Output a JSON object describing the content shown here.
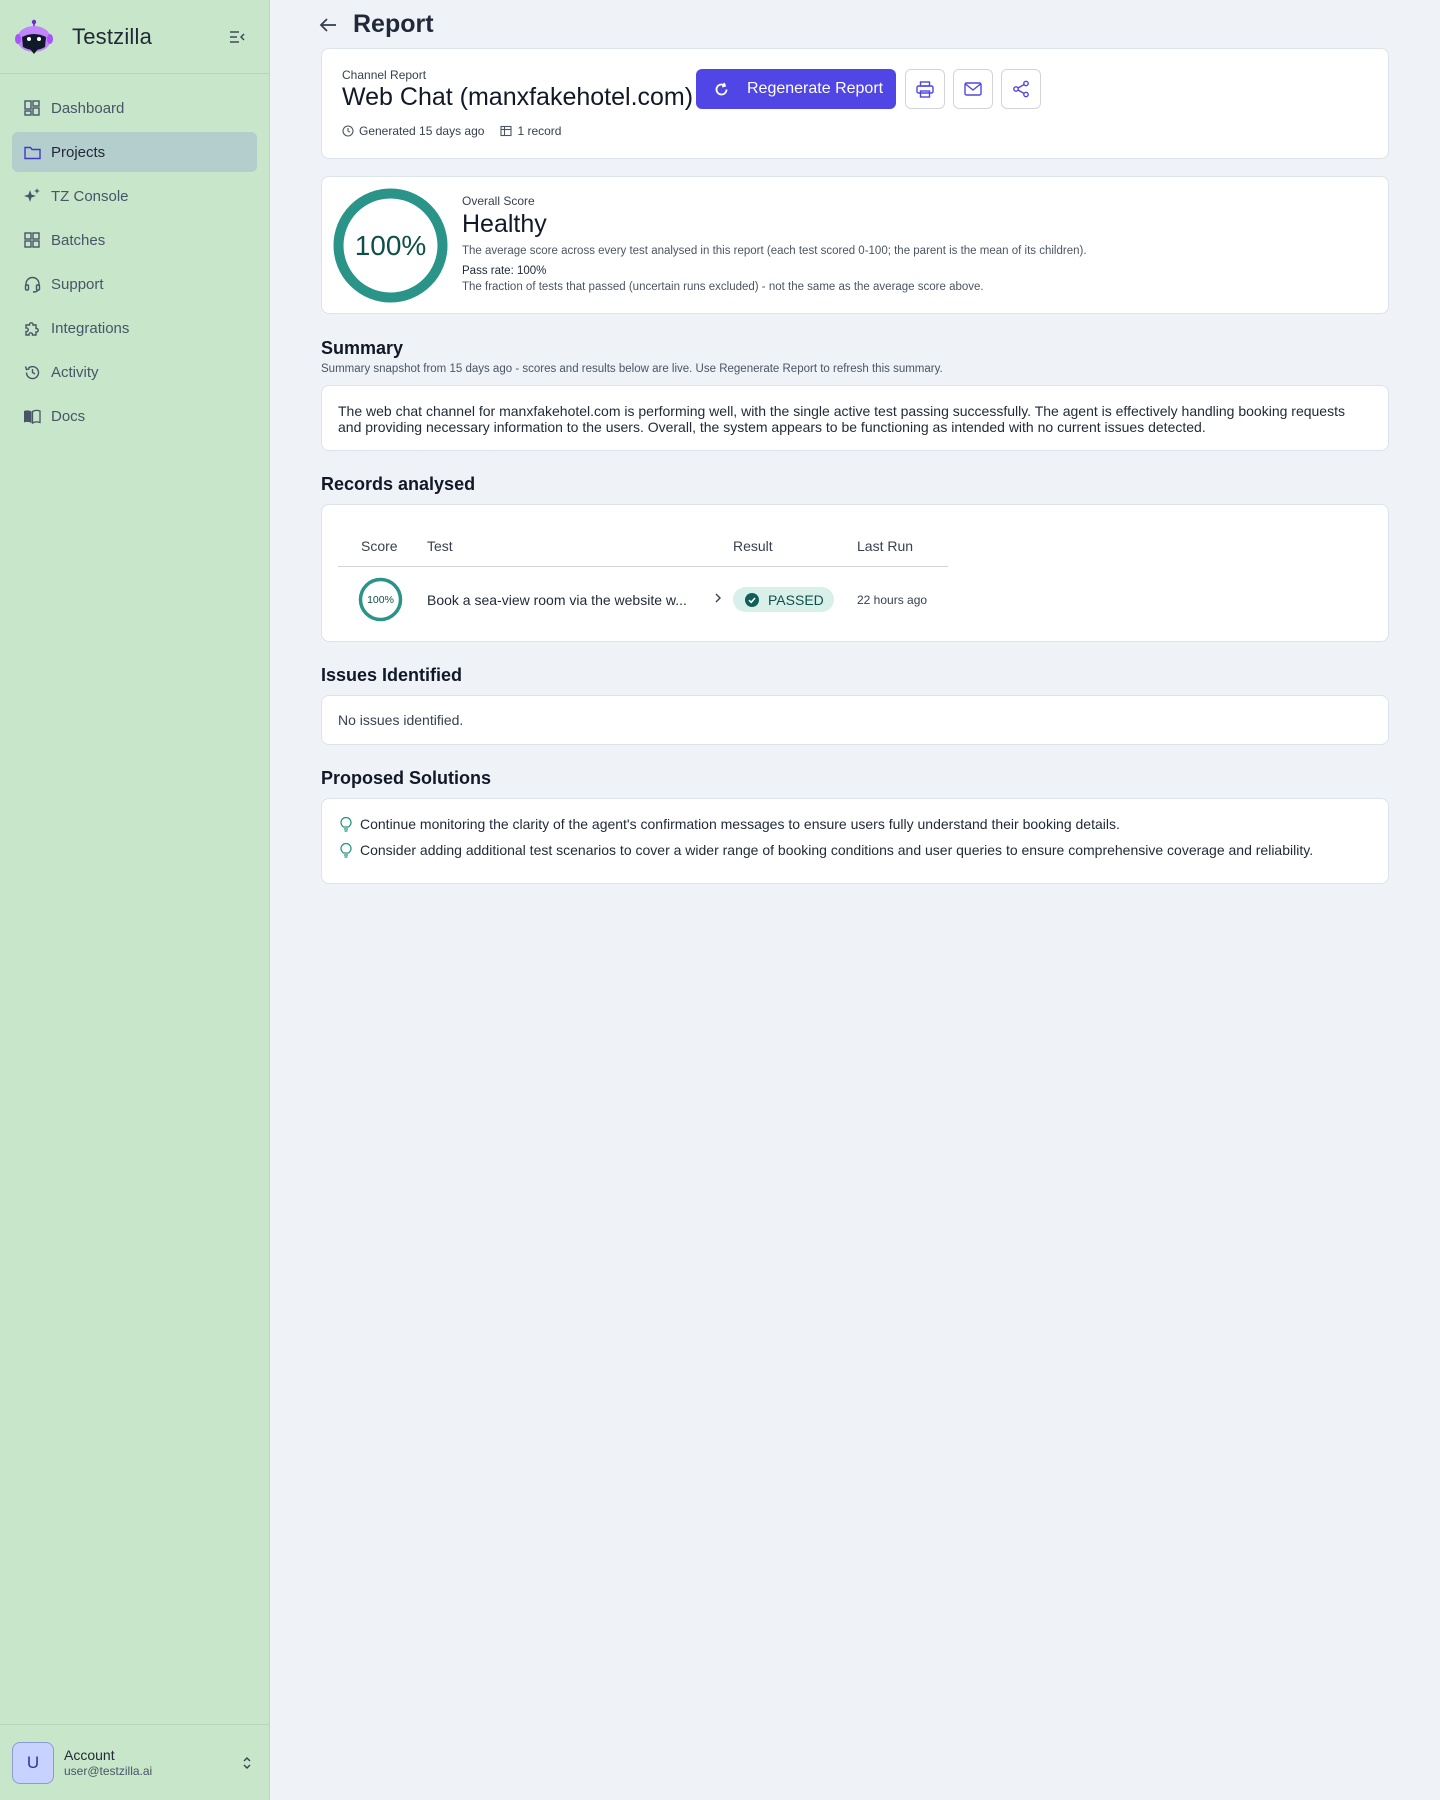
{
  "app": {
    "name": "Testzilla"
  },
  "sidebar": {
    "items": [
      {
        "label": "Dashboard",
        "icon": "dashboard-icon"
      },
      {
        "label": "Projects",
        "icon": "folder-icon",
        "active": true
      },
      {
        "label": "TZ Console",
        "icon": "sparkles-icon"
      },
      {
        "label": "Batches",
        "icon": "grid-icon"
      },
      {
        "label": "Support",
        "icon": "headset-icon"
      },
      {
        "label": "Integrations",
        "icon": "puzzle-icon"
      },
      {
        "label": "Activity",
        "icon": "history-icon"
      },
      {
        "label": "Docs",
        "icon": "book-icon"
      }
    ],
    "account": {
      "initial": "U",
      "name": "Account",
      "email": "user@testzilla.ai"
    }
  },
  "page": {
    "title": "Report"
  },
  "report": {
    "label": "Channel Report",
    "title": "Web Chat (manxfakehotel.com)",
    "regenerate_label": "Regenerate Report",
    "generated": "Generated 15 days ago",
    "records_count": "1 record"
  },
  "score": {
    "value_text": "100%",
    "value": 100,
    "label": "Overall Score",
    "status": "Healthy",
    "description": "The average score across every test analysed in this report (each test scored 0-100; the parent is the mean of its children).",
    "pass_rate": "Pass rate: 100%",
    "pass_rate_description": "The fraction of tests that passed (uncertain runs excluded) - not the same as the average score above.",
    "color": "#2a9488"
  },
  "summary": {
    "title": "Summary",
    "subtitle": "Summary snapshot from 15 days ago - scores and results below are live. Use Regenerate Report to refresh this summary.",
    "text": "The web chat channel for manxfakehotel.com is performing well, with the single active test passing successfully. The agent is effectively handling booking requests and providing necessary information to the users. Overall, the system appears to be functioning as intended with no current issues detected."
  },
  "records": {
    "title": "Records analysed",
    "columns": [
      "Score",
      "Test",
      "Result",
      "Last Run"
    ],
    "rows": [
      {
        "score": "100%",
        "test": "Book a sea-view room via the website w...",
        "result": "PASSED",
        "last_run": "22 hours ago"
      }
    ]
  },
  "issues": {
    "title": "Issues Identified",
    "text": "No issues identified."
  },
  "solutions": {
    "title": "Proposed Solutions",
    "items": [
      "Continue monitoring the clarity of the agent's confirmation messages to ensure users fully understand their booking details.",
      "Consider adding additional test scenarios to cover a wider range of booking conditions and user queries to ensure comprehensive coverage and reliability."
    ]
  },
  "colors": {
    "accent": "#4f46e5",
    "teal": "#2a9488",
    "sidebar_bg": "#c8e6c9"
  }
}
